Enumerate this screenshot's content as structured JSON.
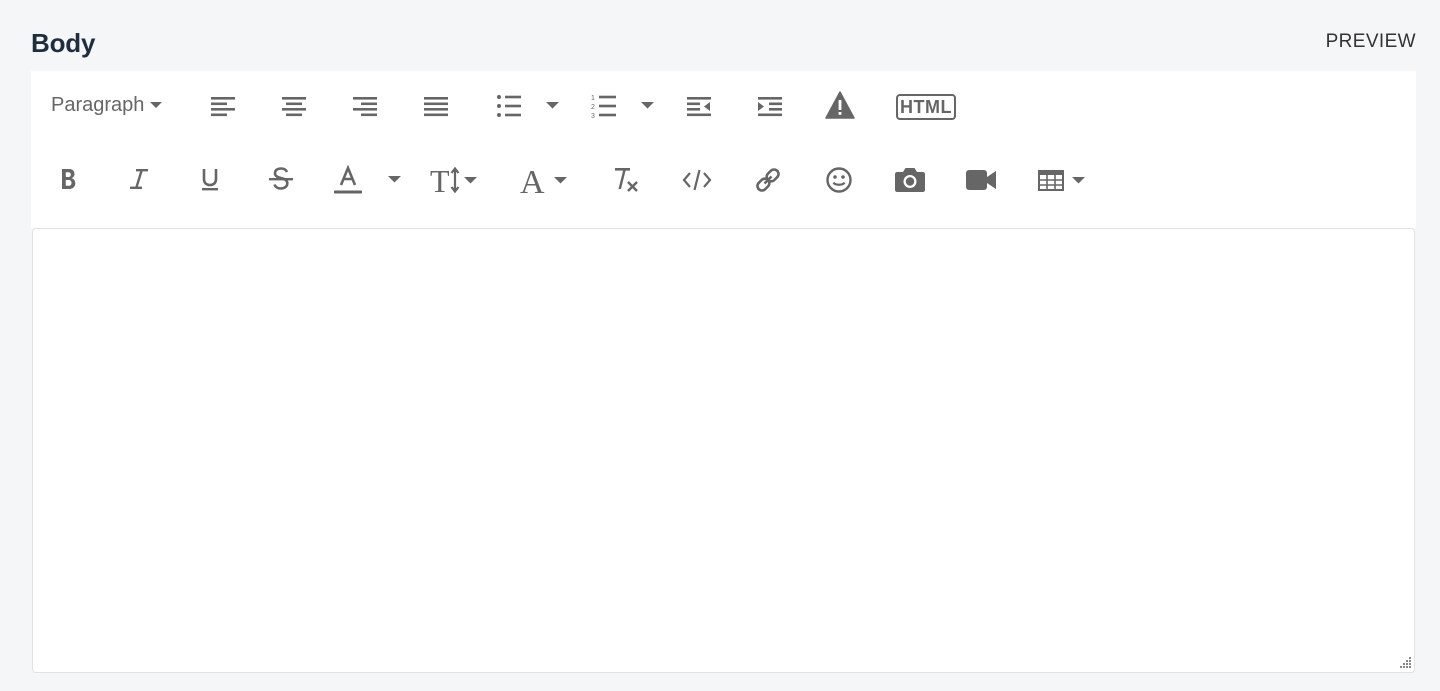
{
  "header": {
    "title": "Body",
    "preview_label": "PREVIEW"
  },
  "toolbar": {
    "paragraph_label": "Paragraph",
    "html_label": "HTML"
  },
  "editor": {
    "content": ""
  },
  "colors": {
    "icon": "#666666",
    "background": "#f4f6f8",
    "title": "#1f2d3d"
  }
}
